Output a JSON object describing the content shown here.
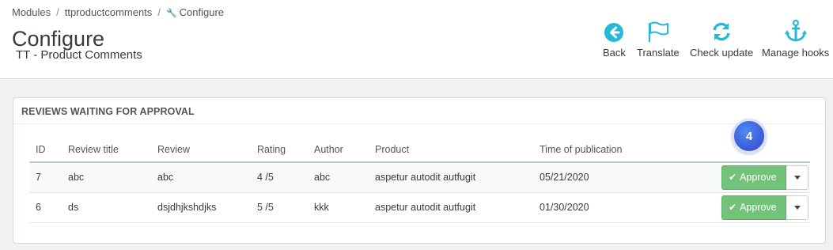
{
  "breadcrumb": {
    "items": [
      "Modules",
      "ttproductcomments"
    ],
    "current": "Configure"
  },
  "page": {
    "title": "Configure",
    "subtitle": "TT - Product Comments"
  },
  "toolbar": {
    "back": "Back",
    "translate": "Translate",
    "check_update": "Check update",
    "manage_hooks": "Manage hooks"
  },
  "panel": {
    "heading": "REVIEWS WAITING FOR APPROVAL",
    "columns": {
      "id": "ID",
      "review_title": "Review title",
      "review": "Review",
      "rating": "Rating",
      "author": "Author",
      "product": "Product",
      "time": "Time of publication"
    },
    "rows": [
      {
        "id": "7",
        "review_title": "abc",
        "review": "abc",
        "rating": "4 /5",
        "author": "abc",
        "product": "aspetur autodit autfugit",
        "time": "05/21/2020",
        "action": "Approve"
      },
      {
        "id": "6",
        "review_title": "ds",
        "review": "dsjdhjkshdjks",
        "rating": "5 /5",
        "author": "kkk",
        "product": "aspetur autodit autfugit",
        "time": "01/30/2020",
        "action": "Approve"
      }
    ]
  },
  "badge": {
    "count": "4"
  },
  "colors": {
    "accent": "#25b9d7",
    "approve": "#72c279",
    "badge": "#3d56d8"
  },
  "icons": {
    "back": "arrow-left-circle-icon",
    "translate": "flag-icon",
    "check_update": "refresh-icon",
    "manage_hooks": "anchor-icon"
  }
}
